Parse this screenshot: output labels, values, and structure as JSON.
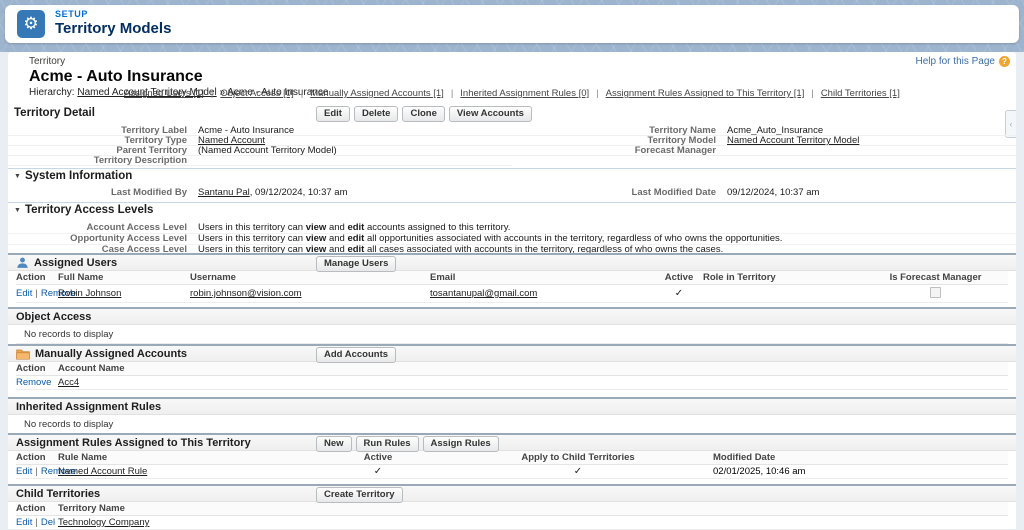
{
  "colors": {
    "brand_blue": "#0070D2",
    "tile_blue": "#3578B5",
    "help_orange": "#F0A431",
    "band_blue": "#9DB4CE",
    "action_link": "#0B5CAB"
  },
  "icons": {
    "gear": "⚙",
    "collapse": "▼",
    "check": "✓",
    "help": "?",
    "pipe": "|",
    "side_tab": "‹"
  },
  "header": {
    "eyebrow": "SETUP",
    "title": "Territory Models"
  },
  "page": {
    "entity": "Territory",
    "title": "Acme - Auto Insurance",
    "hierarchy_label": "Hierarchy:",
    "hierarchy_parent": "Named Account Territory Model",
    "hierarchy_sep": "»",
    "hierarchy_current": "Acme - Auto Insurance",
    "help": "Help for this Page"
  },
  "quick_links": [
    {
      "label": "Assigned Users [1]"
    },
    {
      "label": "Object Access [0]"
    },
    {
      "label": "Manually Assigned Accounts [1]"
    },
    {
      "label": "Inherited Assignment Rules [0]"
    },
    {
      "label": "Assignment Rules Assigned to This Territory [1]"
    },
    {
      "label": "Child Territories [1]"
    }
  ],
  "detail": {
    "title": "Territory Detail",
    "buttons": [
      {
        "label": "Edit"
      },
      {
        "label": "Delete"
      },
      {
        "label": "Clone"
      },
      {
        "label": "View Accounts"
      }
    ],
    "fields_left": [
      {
        "label": "Territory Label",
        "value": "Acme - Auto Insurance"
      },
      {
        "label": "Territory Type",
        "value": "Named Account"
      },
      {
        "label": "Parent Territory",
        "value": "(Named Account Territory Model)"
      },
      {
        "label": "Territory Description",
        "value": ""
      }
    ],
    "fields_right": [
      {
        "label": "Territory Name",
        "value": "Acme_Auto_Insurance"
      },
      {
        "label": "Territory Model",
        "value": "Named Account Territory Model"
      },
      {
        "label": "Forecast Manager",
        "value": ""
      }
    ]
  },
  "system_info": {
    "title": "System Information",
    "left_label": "Last Modified By",
    "left_link": "Santanu Pal",
    "left_rest": ", 09/12/2024, 10:37 am",
    "right_label": "Last Modified Date",
    "right_value": "09/12/2024, 10:37 am"
  },
  "access": {
    "title": "Territory Access Levels",
    "common": {
      "prefix": "Users in this territory can ",
      "bold1": "view",
      "mid": " and ",
      "bold2": "edit"
    },
    "rows": [
      {
        "label": "Account Access Level",
        "suffix": " accounts assigned to this territory."
      },
      {
        "label": "Opportunity Access Level",
        "suffix": " all opportunities associated with accounts in the territory, regardless of who owns the opportunities."
      },
      {
        "label": "Case Access Level",
        "suffix": " all cases associated with accounts in the territory, regardless of who owns the cases."
      }
    ]
  },
  "assigned_users": {
    "title": "Assigned Users",
    "button": "Manage Users",
    "headers": [
      {
        "label": "Action"
      },
      {
        "label": "Full Name"
      },
      {
        "label": "Username"
      },
      {
        "label": "Email"
      },
      {
        "label": "Active"
      },
      {
        "label": "Role in Territory"
      },
      {
        "label": "Is Forecast Manager"
      }
    ],
    "row": {
      "action1": "Edit",
      "action2": "Remove",
      "full_name": "Robin Johnson",
      "username": "robin.johnson@vision.com",
      "email": "tosantanupal@gmail.com",
      "role": ""
    }
  },
  "object_access": {
    "title": "Object Access",
    "empty": "No records to display"
  },
  "manual_accounts": {
    "title": "Manually Assigned Accounts",
    "button": "Add Accounts",
    "headers": [
      {
        "label": "Action"
      },
      {
        "label": "Account Name"
      }
    ],
    "row": {
      "action": "Remove",
      "account": "Acc4"
    }
  },
  "inherited_rules": {
    "title": "Inherited Assignment Rules",
    "empty": "No records to display"
  },
  "assignment_rules": {
    "title": "Assignment Rules Assigned to This Territory",
    "buttons": [
      {
        "label": "New"
      },
      {
        "label": "Run Rules"
      },
      {
        "label": "Assign Rules"
      }
    ],
    "headers": [
      {
        "label": "Action"
      },
      {
        "label": "Rule Name"
      },
      {
        "label": "Active"
      },
      {
        "label": "Apply to Child Territories"
      },
      {
        "label": "Modified Date"
      }
    ],
    "row": {
      "action1": "Edit",
      "action2": "Remove",
      "rule": "Named Account Rule",
      "modified": "02/01/2025, 10:46 am"
    }
  },
  "child_territories": {
    "title": "Child Territories",
    "button": "Create Territory",
    "headers": [
      {
        "label": "Action"
      },
      {
        "label": "Territory Name"
      }
    ],
    "row": {
      "action1": "Edit",
      "action2": "Del",
      "territory": "Technology Company"
    }
  }
}
